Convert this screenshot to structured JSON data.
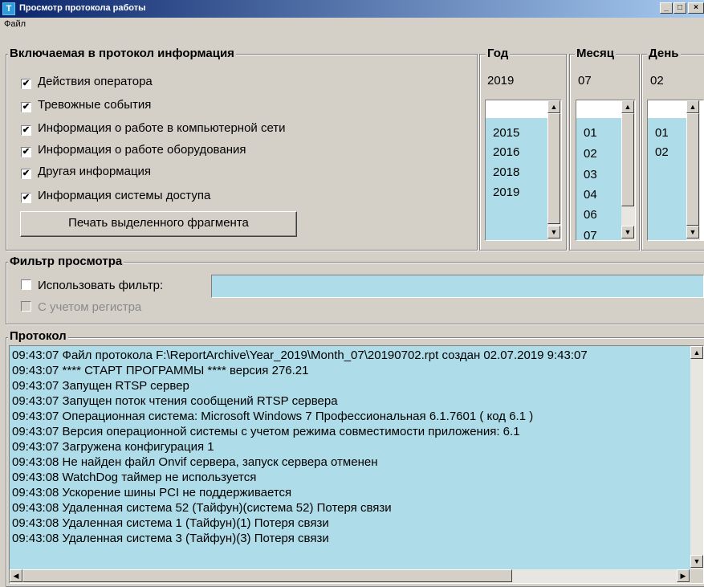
{
  "window": {
    "title": "Просмотр протокола работы",
    "icon_glyph": "T",
    "min_glyph": "_",
    "max_glyph": "□",
    "close_glyph": "×"
  },
  "menu": {
    "file": "Файл"
  },
  "info_group": {
    "title": "Включаемая в протокол информация",
    "checkboxes": [
      {
        "label": "Действия оператора",
        "checked": true
      },
      {
        "label": "Тревожные события",
        "checked": true
      },
      {
        "label": "Информация о работе в компьютерной сети",
        "checked": true
      },
      {
        "label": "Информация о работе оборудования",
        "checked": true
      },
      {
        "label": "Другая информация",
        "checked": true
      },
      {
        "label": "Информация системы доступа",
        "checked": true
      }
    ],
    "print_button": "Печать выделенного фрагмента"
  },
  "year": {
    "title": "Год",
    "value": "2019",
    "items": [
      "2015",
      "2016",
      "2018",
      "2019"
    ]
  },
  "month": {
    "title": "Месяц",
    "value": "07",
    "items": [
      "01",
      "02",
      "03",
      "04",
      "06",
      "07"
    ]
  },
  "day": {
    "title": "День",
    "value": "02",
    "items": [
      "01",
      "02"
    ]
  },
  "filter": {
    "title": "Фильтр просмотра",
    "use_filter_label": "Использовать фильтр:",
    "use_filter_checked": false,
    "filter_value": "",
    "case_label": "С учетом регистра",
    "case_checked": false
  },
  "protocol": {
    "title": "Протокол",
    "lines": [
      "09:43:07 Файл протокола F:\\ReportArchive\\Year_2019\\Month_07\\20190702.rpt создан 02.07.2019 9:43:07",
      "09:43:07 **** СТАРТ ПРОГРАММЫ **** версия 276.21",
      "09:43:07 Запущен RTSP сервер",
      "09:43:07 Запущен поток чтения сообщений RTSP сервера",
      "09:43:07 Операционная система: Microsoft Windows 7 Профессиональная  6.1.7601 ( код 6.1 )",
      "09:43:07 Версия операционной системы с учетом режима совместимости приложения: 6.1",
      "09:43:07 Загружена конфигурация 1",
      "09:43:08 Не найден файл Onvif сервера, запуск сервера отменен",
      "09:43:08 WatchDog таймер не используется",
      "09:43:08 Ускорение шины PCI не поддерживается",
      "09:43:08 Удаленная система 52 (Тайфун)(система 52) Потеря связи",
      "09:43:08 Удаленная система 1 (Тайфун)(1) Потеря связи",
      "09:43:08 Удаленная система 3 (Тайфун)(3) Потеря связи"
    ]
  },
  "colors": {
    "list_bg": "#aedce8",
    "window_bg": "#d4d0c8",
    "titlebar": "#0a246a"
  }
}
